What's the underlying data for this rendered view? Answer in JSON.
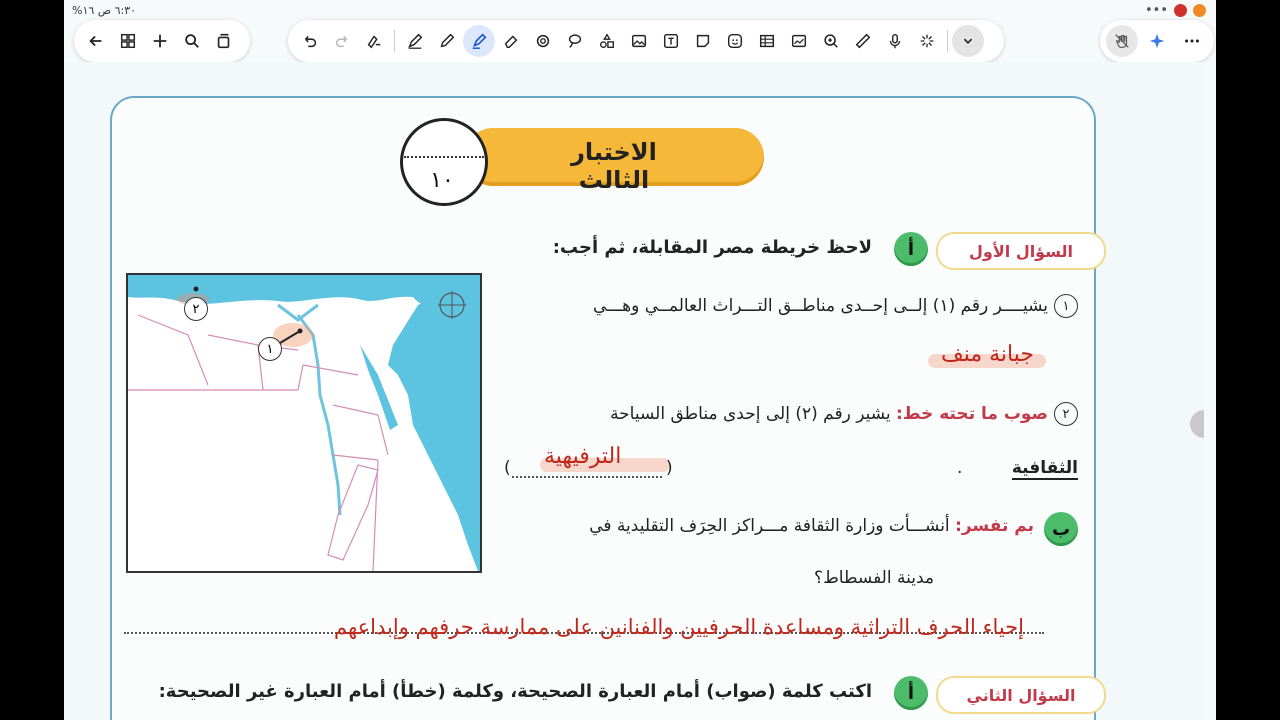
{
  "status_bar": {
    "left_text": "٦:٣٠ ص ١٦%"
  },
  "toolbar": {
    "left_icons": [
      "back-arrow-icon",
      "grid-icon",
      "plus-icon",
      "search-icon",
      "copy-icon"
    ],
    "main_icons": [
      "undo-icon",
      "redo-icon",
      "lasso-icon",
      "pen-icon",
      "pencil-icon",
      "highlighter-icon",
      "eraser-icon",
      "shape-icon",
      "lasso-select-icon",
      "shapes-icon",
      "image-icon",
      "text-icon",
      "sticky-note-icon",
      "sticker-icon",
      "table-icon",
      "media-icon",
      "zoom-icon",
      "ruler-icon",
      "mic-icon",
      "laser-icon",
      "more-down-icon"
    ],
    "right_icons": [
      "hand-off-icon",
      "sparkle-icon",
      "more-icon"
    ]
  },
  "document": {
    "title": "الاختبار الثالث",
    "score": "١٠",
    "q1": {
      "badge": "السؤال الأول",
      "letter_a": "أ",
      "prompt": "لاحظ خريطة مصر المقابلة، ثم أجب:",
      "item1_num": "١",
      "item1_text": "يشيــــر رقم (١) إلــى إحــدى مناطــق التـــراث العالمــي وهـــي",
      "item1_answer": "جبانة منف",
      "item2_num": "٢",
      "item2_label": "صوب ما تحته خط:",
      "item2_text": "يشير رقم (٢) إلى إحدى مناطق السياحة",
      "item2_underlined": "الثقافية",
      "item2_answer": "الترفيهية",
      "letter_b": "ب",
      "b_label": "بم تفسر:",
      "b_text_1": "أنشـــأت وزارة الثقافة مـــراكز الحِرَف التقليدية في",
      "b_text_2": "مدينة الفسطاط؟",
      "b_answer": "إحياء الحرف التراثية ومساعدة الحرفيين والفنانين على ممارسة حرفهم وإبداعهم"
    },
    "q2": {
      "badge": "السؤال الثاني",
      "letter_a": "أ",
      "prompt": "اكتب كلمة (صواب) أمام العبارة الصحيحة، وكلمة (خطأ) أمام العبارة غير الصحيحة:"
    },
    "map_labels": {
      "one": "١",
      "two": "٢"
    }
  }
}
